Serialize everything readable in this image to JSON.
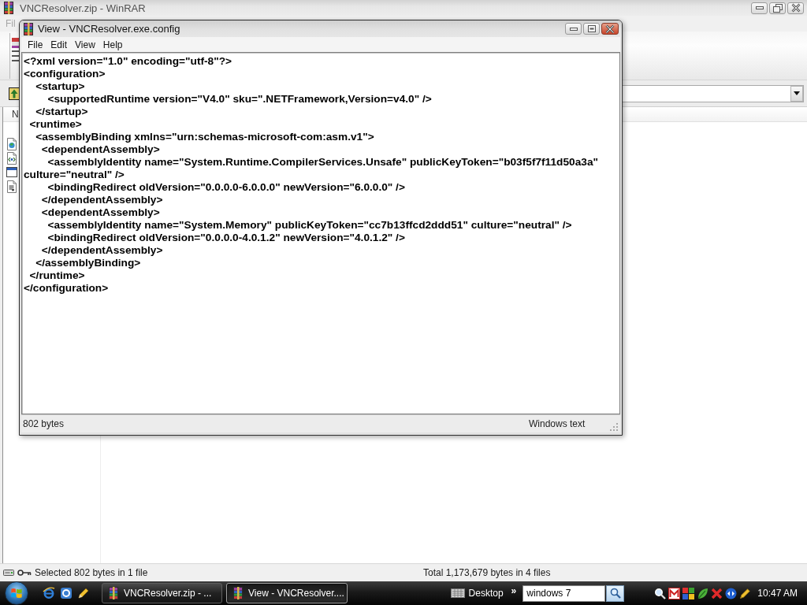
{
  "winrar_window": {
    "title": "VNCResolver.zip - WinRAR",
    "menu": [
      "Fil"
    ],
    "list": {
      "columns": [
        "N"
      ],
      "files": [
        {
          "kind": "globe"
        },
        {
          "kind": "markup"
        },
        {
          "kind": "window"
        },
        {
          "kind": "plain"
        }
      ]
    },
    "status_bar": {
      "selection": "Selected 802 bytes in 1 file",
      "total": "Total 1,173,679 bytes in 4 files"
    }
  },
  "viewer_window": {
    "title": "View - VNCResolver.exe.config",
    "menu": [
      "File",
      "Edit",
      "View",
      "Help"
    ],
    "lines": [
      "<?xml version=\"1.0\" encoding=\"utf-8\"?>",
      "<configuration>",
      "    <startup>",
      "        <supportedRuntime version=\"V4.0\" sku=\".NETFramework,Version=v4.0\" />",
      "    </startup>",
      "  <runtime>",
      "    <assemblyBinding xmlns=\"urn:schemas-microsoft-com:asm.v1\">",
      "      <dependentAssembly>",
      "        <assemblyIdentity name=\"System.Runtime.CompilerServices.Unsafe\" publicKeyToken=\"b03f5f7f11d50a3a\"",
      "culture=\"neutral\" />",
      "        <bindingRedirect oldVersion=\"0.0.0.0-6.0.0.0\" newVersion=\"6.0.0.0\" />",
      "      </dependentAssembly>",
      "      <dependentAssembly>",
      "        <assemblyIdentity name=\"System.Memory\" publicKeyToken=\"cc7b13ffcd2ddd51\" culture=\"neutral\" />",
      "        <bindingRedirect oldVersion=\"0.0.0.0-4.0.1.2\" newVersion=\"4.0.1.2\" />",
      "      </dependentAssembly>",
      "    </assemblyBinding>",
      "  </runtime>",
      "</configuration>"
    ],
    "status_bar": {
      "size": "802 bytes",
      "encoding": "Windows text"
    }
  },
  "taskbar": {
    "tasks": [
      {
        "label": "VNCResolver.zip - ...",
        "selected": false
      },
      {
        "label": "View - VNCResolver....",
        "selected": true
      }
    ],
    "toolbar": {
      "label": "Desktop",
      "chevron": "»"
    },
    "search": {
      "value": "windows 7"
    },
    "clock": "10:47 AM"
  }
}
